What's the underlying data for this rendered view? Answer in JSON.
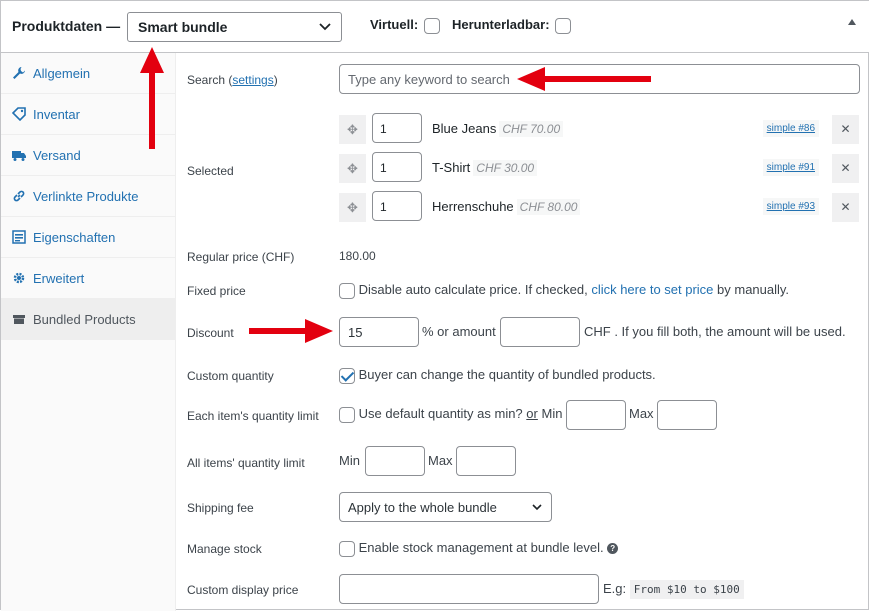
{
  "header": {
    "title": "Produktdaten —",
    "product_type": "Smart bundle",
    "virtual_label": "Virtuell:",
    "downloadable_label": "Herunterladbar:"
  },
  "sidebar": {
    "items": [
      {
        "label": "Allgemein",
        "icon": "wrench-icon"
      },
      {
        "label": "Inventar",
        "icon": "tag-icon"
      },
      {
        "label": "Versand",
        "icon": "truck-icon"
      },
      {
        "label": "Verlinkte Produkte",
        "icon": "link-icon"
      },
      {
        "label": "Eigenschaften",
        "icon": "list-icon"
      },
      {
        "label": "Erweitert",
        "icon": "gear-icon"
      },
      {
        "label": "Bundled Products",
        "icon": "box-icon"
      }
    ]
  },
  "search": {
    "label": "Search (",
    "settings_link": "settings",
    "label_end": ")",
    "placeholder": "Type any keyword to search"
  },
  "selected": {
    "label": "Selected",
    "items": [
      {
        "qty": "1",
        "name": "Blue Jeans",
        "price": "CHF 70.00",
        "link": "simple #86"
      },
      {
        "qty": "1",
        "name": "T-Shirt",
        "price": "CHF 30.00",
        "link": "simple #91"
      },
      {
        "qty": "1",
        "name": "Herrenschuhe",
        "price": "CHF 80.00",
        "link": "simple #93"
      }
    ]
  },
  "regular_price": {
    "label": "Regular price (CHF)",
    "value": "180.00"
  },
  "fixed_price": {
    "label": "Fixed price",
    "text_before": "Disable auto calculate price. If checked, ",
    "link": "click here to set price",
    "text_after": " by manually."
  },
  "discount": {
    "label": "Discount",
    "percent_value": "15",
    "mid_text": "% or amount",
    "amount_value": "",
    "end_text": "CHF . If you fill both, the amount will be used."
  },
  "custom_quantity": {
    "label": "Custom quantity",
    "text": "Buyer can change the quantity of bundled products.",
    "checked": true
  },
  "each_limit": {
    "label": "Each item's quantity limit",
    "text": "Use default quantity as min?",
    "or": "or",
    "min_label": "Min",
    "max_label": "Max"
  },
  "all_limit": {
    "label": "All items' quantity limit",
    "min_label": "Min",
    "max_label": "Max"
  },
  "shipping_fee": {
    "label": "Shipping fee",
    "value": "Apply to the whole bundle"
  },
  "manage_stock": {
    "label": "Manage stock",
    "text": "Enable stock management at bundle level."
  },
  "custom_display_price": {
    "label": "Custom display price",
    "eg": "E.g:",
    "example": "From $10 to $100"
  },
  "colors": {
    "accent": "#2271b1",
    "annotation_arrow": "#e3000f"
  }
}
